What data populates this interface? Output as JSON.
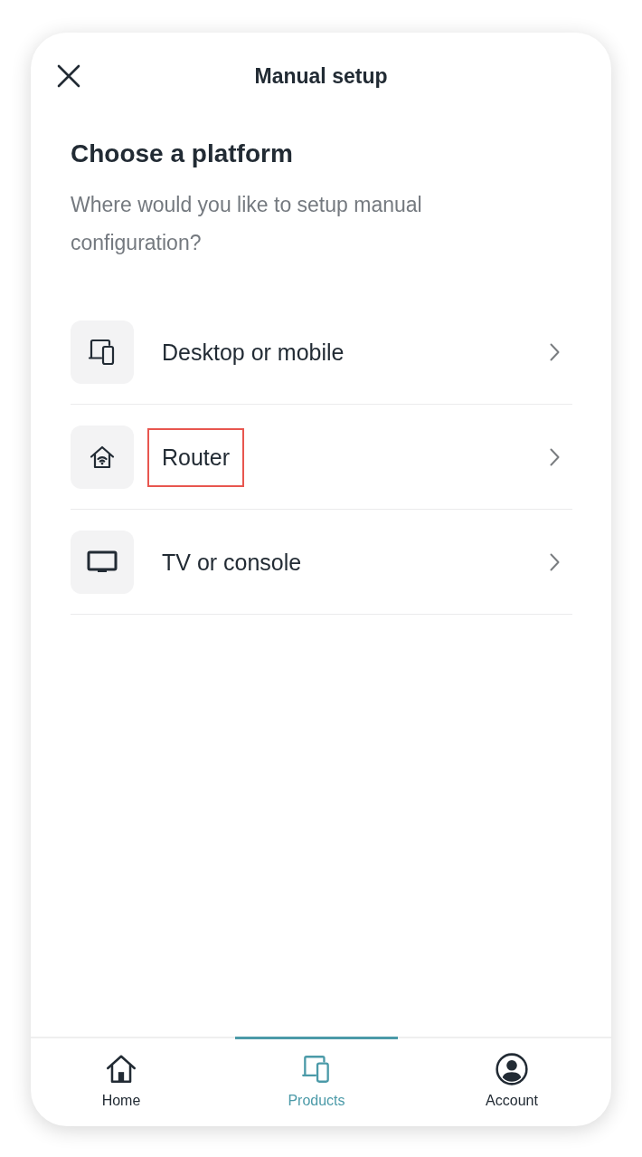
{
  "header": {
    "title": "Manual setup"
  },
  "heading": "Choose a platform",
  "subtitle": "Where would you like to setup manual configuration?",
  "options": [
    {
      "kind": "devices",
      "label": "Desktop or mobile",
      "highlighted": false
    },
    {
      "kind": "router",
      "label": "Router",
      "highlighted": true
    },
    {
      "kind": "tv",
      "label": "TV or console",
      "highlighted": false
    }
  ],
  "nav": [
    {
      "kind": "home",
      "label": "Home",
      "selected": false
    },
    {
      "kind": "products",
      "label": "Products",
      "selected": true
    },
    {
      "kind": "account",
      "label": "Account",
      "selected": false
    }
  ]
}
